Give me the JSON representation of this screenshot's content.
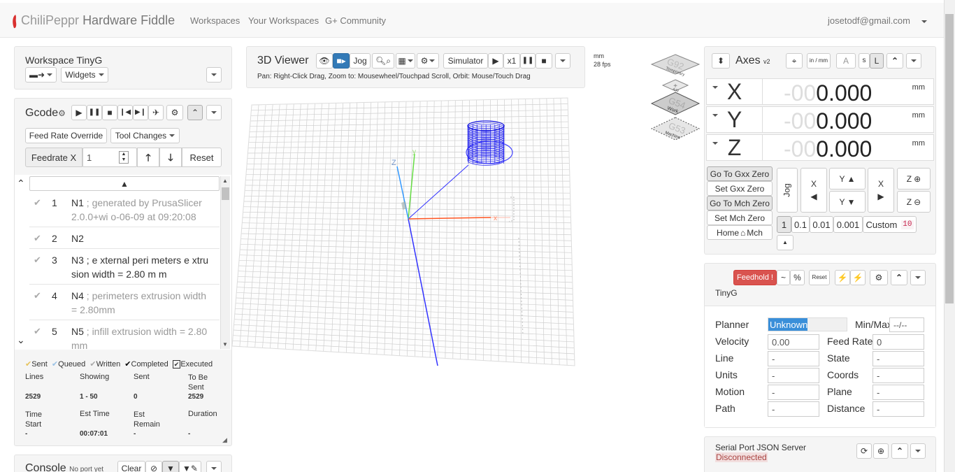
{
  "navbar": {
    "brand_chili": "ChiliPeppr",
    "brand_rest": "Hardware Fiddle",
    "links": [
      "Workspaces",
      "Your Workspaces",
      "G+ Community"
    ],
    "user": "josetodf@gmail.com"
  },
  "workspace": {
    "title": "Workspace TinyG",
    "widgets_label": "Widgets"
  },
  "gcode": {
    "title": "Gcode",
    "feed_rate_override": "Feed Rate Override",
    "tool_changes": "Tool Changes",
    "feedrate_label": "Feedrate X",
    "feedrate_value": "1",
    "reset": "Reset",
    "lines": [
      {
        "n": "1",
        "code": "N1",
        "comment": " ; generated by PrusaSlicer 2.0.0+wi o-06-09 at 09:20:08"
      },
      {
        "n": "2",
        "code": "N2",
        "comment": ""
      },
      {
        "n": "3",
        "code": "N3",
        "comment": " ; e xternal peri meters e xtru sion width = 2.80 m m"
      },
      {
        "n": "4",
        "code": "N4",
        "comment": " ; perimeters extrusion width = 2.80mm"
      },
      {
        "n": "5",
        "code": "N5",
        "comment": " ; infill extrusion width = 2.80 mm"
      }
    ],
    "legend": {
      "sent": "Sent",
      "queued": "Queued",
      "written": "Written",
      "completed": "Completed",
      "executed": "Executed"
    },
    "stats_labels": {
      "lines": "Lines",
      "showing": "Showing",
      "sent": "Sent",
      "to_be_sent": "To Be Sent",
      "time_start": "Time Start",
      "est_time": "Est Time",
      "est_remain": "Est Remain",
      "duration": "Duration"
    },
    "stats": {
      "lines": "2529",
      "showing": "1 - 50",
      "sent": "0",
      "to_be_sent": "2529",
      "time_start": "-",
      "est_time": "00:07:01",
      "est_remain": "-",
      "duration": "-"
    }
  },
  "console": {
    "title": "Console",
    "subtitle": "No port yet",
    "clear": "Clear"
  },
  "viewer": {
    "title": "3D Viewer",
    "jog": "Jog",
    "simulator": "Simulator",
    "speed": "x1",
    "help": "Pan: Right-Click Drag, Zoom to: Mousewheel/Touchpad Scroll, Orbit: Mouse/Touch Drag",
    "units": "mm",
    "fps": "28 fps"
  },
  "wcs": {
    "g92": "G92",
    "g92_sub": "Temporary",
    "add": "Add",
    "g54": "G54",
    "g54_sub": "Work",
    "g53": "G53",
    "g53_sub": "Machine"
  },
  "axes": {
    "title": "Axes",
    "version": "v2",
    "inmm": "in / mm",
    "s": "s",
    "l": "L",
    "rows": [
      {
        "name": "X",
        "ghost": "-00",
        "value": "0.000",
        "unit": "mm"
      },
      {
        "name": "Y",
        "ghost": "-00",
        "value": "0.000",
        "unit": "mm"
      },
      {
        "name": "Z",
        "ghost": "-00",
        "value": "0.000",
        "unit": "mm"
      }
    ],
    "go_gxx_zero": "Go To Gxx Zero",
    "set_gxx_zero": "Set Gxx Zero",
    "go_mch_zero": "Go To Mch Zero",
    "set_mch_zero": "Set Mch Zero",
    "home": "Home",
    "mch": "Mch",
    "jog": "Jog",
    "x": "X",
    "y": "Y",
    "z": "Z",
    "steps": [
      "1",
      "0.1",
      "0.01",
      "0.001"
    ],
    "custom": "Custom",
    "custom_value": "10"
  },
  "tinyg": {
    "feedhold": "Feedhold !",
    "tilde": "~",
    "pct": "%",
    "reset": "Reset",
    "title": "TinyG",
    "planner_label": "Planner",
    "planner_value": "Unknown",
    "planner_level": 0.5,
    "minmax_label": "Min/Max",
    "minmax_value": "--/--",
    "velocity_label": "Velocity",
    "velocity_value": "0.00",
    "feedrate_label": "Feed Rate",
    "feedrate_value": "0",
    "line_label": "Line",
    "line_value": "-",
    "state_label": "State",
    "state_value": "-",
    "units_label": "Units",
    "units_value": "-",
    "coords_label": "Coords",
    "coords_value": "-",
    "motion_label": "Motion",
    "motion_value": "-",
    "plane_label": "Plane",
    "plane_value": "-",
    "path_label": "Path",
    "path_value": "-",
    "distance_label": "Distance",
    "distance_value": "-"
  },
  "serial": {
    "title": "Serial Port JSON Server",
    "status": "Disconnected"
  }
}
